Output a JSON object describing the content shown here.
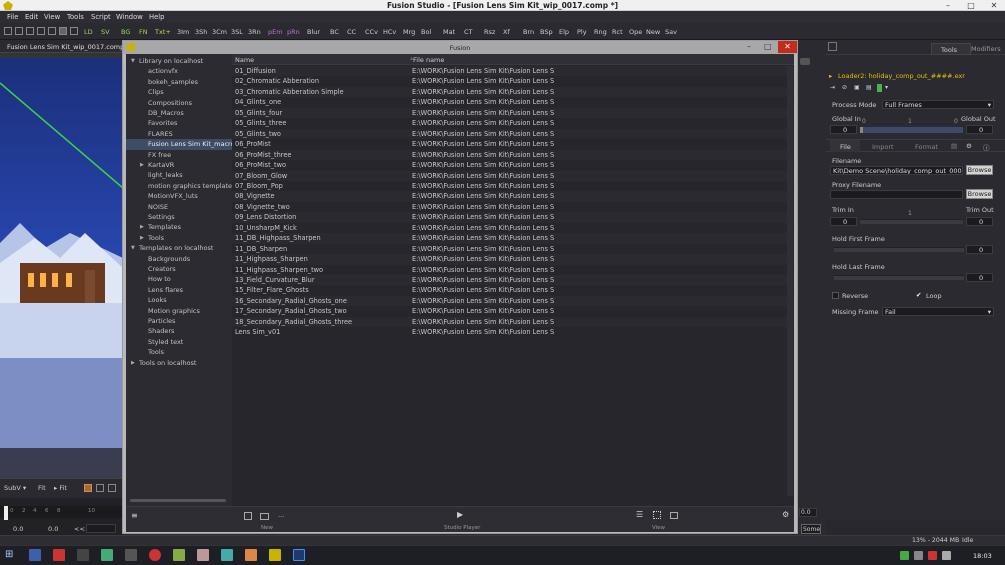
{
  "window": {
    "title": "Fusion Studio - [Fusion Lens Sim Kit_wip_0017.comp *]"
  },
  "menu": [
    "File",
    "Edit",
    "View",
    "Tools",
    "Script",
    "Window",
    "Help"
  ],
  "toolbar": {
    "buttons": [
      "LD",
      "SV",
      "BG",
      "FN",
      "Txt+",
      "3Im",
      "3Sh",
      "3Cm",
      "3SL",
      "3Rn",
      "pEm",
      "pRn",
      "Blur",
      "BC",
      "CC",
      "CCv",
      "HCv",
      "Mrg",
      "Bol",
      "Mat",
      "CT",
      "Rsz",
      "Xf",
      "Brn",
      "BSp",
      "Elp",
      "Ply",
      "Rng",
      "Rct",
      "Ope",
      "New",
      "Sav"
    ],
    "colors": {
      "LD": "#9cd85a",
      "SV": "#9cd85a",
      "BG": "#9cd85a",
      "FN": "#9cd85a",
      "Txt+": "#d5d560",
      "pEm": "#c070d8",
      "pRn": "#c070d8"
    }
  },
  "viewer": {
    "tab": "Fusion Lens Sim Kit_wip_0017.comp *",
    "controls": [
      "SubV ▾",
      "Fit",
      "▸ Fit"
    ],
    "timeline": {
      "ticks": [
        "0",
        "2",
        "4",
        "6",
        "8",
        "10"
      ],
      "cur": "0",
      "start": "0.0",
      "end": "0.0",
      "nav": "<<"
    }
  },
  "dialog": {
    "title": "Fusion",
    "tree": [
      {
        "label": "Library on localhost",
        "level": 0,
        "arrow": "down"
      },
      {
        "label": "actionvfx",
        "level": 1
      },
      {
        "label": "bokeh_samples",
        "level": 1
      },
      {
        "label": "Clips",
        "level": 1
      },
      {
        "label": "Compositions",
        "level": 1
      },
      {
        "label": "DB_Macros",
        "level": 1
      },
      {
        "label": "Favorites",
        "level": 1
      },
      {
        "label": "FLARES",
        "level": 1
      },
      {
        "label": "Fusion Lens Sim Kit_macros",
        "level": 1,
        "selected": true
      },
      {
        "label": "FX free",
        "level": 1
      },
      {
        "label": "KartaVR",
        "level": 1,
        "arrow": "right"
      },
      {
        "label": "light_leaks",
        "level": 1
      },
      {
        "label": "motion graphics templates",
        "level": 1
      },
      {
        "label": "MotionVFX_luts",
        "level": 1
      },
      {
        "label": "NOISE",
        "level": 1
      },
      {
        "label": "Settings",
        "level": 1
      },
      {
        "label": "Templates",
        "level": 1,
        "arrow": "right"
      },
      {
        "label": "Tools",
        "level": 1,
        "arrow": "right"
      },
      {
        "label": "Templates on localhost",
        "level": 0,
        "arrow": "down"
      },
      {
        "label": "Backgrounds",
        "level": 1
      },
      {
        "label": "Creators",
        "level": 1
      },
      {
        "label": "How to",
        "level": 1
      },
      {
        "label": "Lens flares",
        "level": 1
      },
      {
        "label": "Looks",
        "level": 1
      },
      {
        "label": "Motion graphics",
        "level": 1
      },
      {
        "label": "Particles",
        "level": 1
      },
      {
        "label": "Shaders",
        "level": 1
      },
      {
        "label": "Styled text",
        "level": 1
      },
      {
        "label": "Tools",
        "level": 1
      },
      {
        "label": "Tools on localhost",
        "level": 0,
        "arrow": "right"
      }
    ],
    "columns": {
      "name": "Name",
      "file": "File name"
    },
    "files": [
      {
        "name": "01_Diffusion",
        "path": "E:\\WORK\\Fusion Lens Sim Kit\\Fusion Lens S"
      },
      {
        "name": "02_Chromatic Abberation",
        "path": "E:\\WORK\\Fusion Lens Sim Kit\\Fusion Lens S"
      },
      {
        "name": "03_Chromatic Abberation Simple",
        "path": "E:\\WORK\\Fusion Lens Sim Kit\\Fusion Lens S"
      },
      {
        "name": "04_Glints_one",
        "path": "E:\\WORK\\Fusion Lens Sim Kit\\Fusion Lens S"
      },
      {
        "name": "05_Glints_four",
        "path": "E:\\WORK\\Fusion Lens Sim Kit\\Fusion Lens S"
      },
      {
        "name": "05_Glints_three",
        "path": "E:\\WORK\\Fusion Lens Sim Kit\\Fusion Lens S"
      },
      {
        "name": "05_Glints_two",
        "path": "E:\\WORK\\Fusion Lens Sim Kit\\Fusion Lens S"
      },
      {
        "name": "06_ProMist",
        "path": "E:\\WORK\\Fusion Lens Sim Kit\\Fusion Lens S"
      },
      {
        "name": "06_ProMist_three",
        "path": "E:\\WORK\\Fusion Lens Sim Kit\\Fusion Lens S"
      },
      {
        "name": "06_ProMist_two",
        "path": "E:\\WORK\\Fusion Lens Sim Kit\\Fusion Lens S"
      },
      {
        "name": "07_Bloom_Glow",
        "path": "E:\\WORK\\Fusion Lens Sim Kit\\Fusion Lens S"
      },
      {
        "name": "07_Bloom_Pop",
        "path": "E:\\WORK\\Fusion Lens Sim Kit\\Fusion Lens S"
      },
      {
        "name": "08_Vignette",
        "path": "E:\\WORK\\Fusion Lens Sim Kit\\Fusion Lens S"
      },
      {
        "name": "08_Vignette_two",
        "path": "E:\\WORK\\Fusion Lens Sim Kit\\Fusion Lens S"
      },
      {
        "name": "09_Lens Distortion",
        "path": "E:\\WORK\\Fusion Lens Sim Kit\\Fusion Lens S"
      },
      {
        "name": "10_UnsharpM_Kick",
        "path": "E:\\WORK\\Fusion Lens Sim Kit\\Fusion Lens S"
      },
      {
        "name": "11_DB_Highpass_Sharpen",
        "path": "E:\\WORK\\Fusion Lens Sim Kit\\Fusion Lens S"
      },
      {
        "name": "11_DB_Sharpen",
        "path": "E:\\WORK\\Fusion Lens Sim Kit\\Fusion Lens S"
      },
      {
        "name": "11_Highpass_Sharpen",
        "path": "E:\\WORK\\Fusion Lens Sim Kit\\Fusion Lens S"
      },
      {
        "name": "11_Highpass_Sharpen_two",
        "path": "E:\\WORK\\Fusion Lens Sim Kit\\Fusion Lens S"
      },
      {
        "name": "13_Field_Curvature_Blur",
        "path": "E:\\WORK\\Fusion Lens Sim Kit\\Fusion Lens S"
      },
      {
        "name": "15_Filter_Flare_Ghosts",
        "path": "E:\\WORK\\Fusion Lens Sim Kit\\Fusion Lens S"
      },
      {
        "name": "16_Secondary_Radial_Ghosts_one",
        "path": "E:\\WORK\\Fusion Lens Sim Kit\\Fusion Lens S"
      },
      {
        "name": "17_Secondary_Radial_Ghosts_two",
        "path": "E:\\WORK\\Fusion Lens Sim Kit\\Fusion Lens S"
      },
      {
        "name": "18_Secondary_Radial_Ghosts_three",
        "path": "E:\\WORK\\Fusion Lens Sim Kit\\Fusion Lens S"
      },
      {
        "name": "Lens Sim_v01",
        "path": "E:\\WORK\\Fusion Lens Sim Kit\\Fusion Lens S"
      }
    ],
    "footer": {
      "new": "New",
      "player": "Studio Player",
      "view": "View",
      "ellipsis": "..."
    }
  },
  "inspector": {
    "tabs": {
      "tools": "Tools",
      "modifiers": "Modifiers"
    },
    "node_title": "Loader2: holiday_comp_out_####.exr",
    "process_mode_label": "Process Mode",
    "process_mode": "Full Frames",
    "global_in_label": "Global In",
    "global_out_label": "Global Out",
    "global_in": "0",
    "global_out": "0",
    "range_marks": [
      "0",
      "1",
      "0"
    ],
    "subtabs": {
      "file": "File",
      "import": "Import",
      "format": "Format"
    },
    "filename_label": "Filename",
    "filename": "Kit\\Demo Scene\\holiday_comp_out_0000.exr",
    "browse": "Browse",
    "proxy_label": "Proxy Filename",
    "trim_in_label": "Trim In",
    "trim_out_label": "Trim Out",
    "trim_in": "0",
    "trim_out": "0",
    "trim_mid": "1",
    "hold_first_label": "Hold First Frame",
    "hold_first": "0",
    "hold_last_label": "Hold Last Frame",
    "hold_last": "0",
    "reverse": "Reverse",
    "loop": "Loop",
    "missing_label": "Missing Frame",
    "missing": "Fail"
  },
  "canvas": {
    "value": "0.0",
    "some": "Some"
  },
  "status": {
    "memory": "13% - 2044 MB",
    "state": "Idle"
  },
  "taskbar": {
    "time": "18:03"
  }
}
